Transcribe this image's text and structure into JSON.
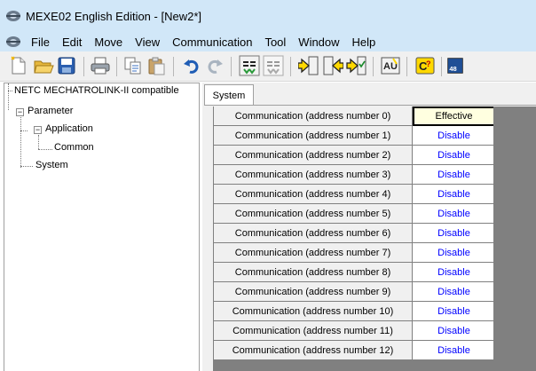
{
  "window": {
    "title": "MEXE02 English Edition - [New2*]",
    "app_icon": "mexe-app-icon"
  },
  "menubar": {
    "items": [
      {
        "label": "File"
      },
      {
        "label": "Edit"
      },
      {
        "label": "Move"
      },
      {
        "label": "View"
      },
      {
        "label": "Communication"
      },
      {
        "label": "Tool"
      },
      {
        "label": "Window"
      },
      {
        "label": "Help"
      }
    ]
  },
  "toolbar": {
    "buttons": [
      {
        "icon": "new-file-icon"
      },
      {
        "icon": "open-folder-icon"
      },
      {
        "icon": "save-icon"
      },
      {
        "icon": "print-icon"
      },
      {
        "icon": "copy-icon"
      },
      {
        "icon": "paste-icon"
      },
      {
        "icon": "undo-icon"
      },
      {
        "icon": "redo-icon"
      },
      {
        "icon": "compare-icon"
      },
      {
        "icon": "compare-disabled-icon"
      },
      {
        "icon": "read-from-device-icon"
      },
      {
        "icon": "write-to-device-icon"
      },
      {
        "icon": "verify-icon"
      },
      {
        "icon": "data-transfer-icon"
      },
      {
        "icon": "unit-settings-icon"
      },
      {
        "icon": "more-icon"
      }
    ]
  },
  "tree": {
    "root": "NETC MECHATROLINK-II compatible",
    "parameter": "Parameter",
    "application": "Application",
    "common": "Common",
    "system": "System"
  },
  "tab": {
    "label": "System"
  },
  "table": {
    "rows": [
      {
        "label": "Communication (address number 0)",
        "value": "Effective",
        "selected": true
      },
      {
        "label": "Communication (address number 1)",
        "value": "Disable"
      },
      {
        "label": "Communication (address number 2)",
        "value": "Disable"
      },
      {
        "label": "Communication (address number 3)",
        "value": "Disable"
      },
      {
        "label": "Communication (address number 4)",
        "value": "Disable"
      },
      {
        "label": "Communication (address number 5)",
        "value": "Disable"
      },
      {
        "label": "Communication (address number 6)",
        "value": "Disable"
      },
      {
        "label": "Communication (address number 7)",
        "value": "Disable"
      },
      {
        "label": "Communication (address number 8)",
        "value": "Disable"
      },
      {
        "label": "Communication (address number 9)",
        "value": "Disable"
      },
      {
        "label": "Communication (address number 10)",
        "value": "Disable"
      },
      {
        "label": "Communication (address number 11)",
        "value": "Disable"
      },
      {
        "label": "Communication (address number 12)",
        "value": "Disable"
      }
    ]
  },
  "colors": {
    "titlebar_bg": "#d1e7f8",
    "value_text": "#0000ff",
    "selected_cell_bg": "#ffffe0",
    "grid_line": "#808080"
  }
}
